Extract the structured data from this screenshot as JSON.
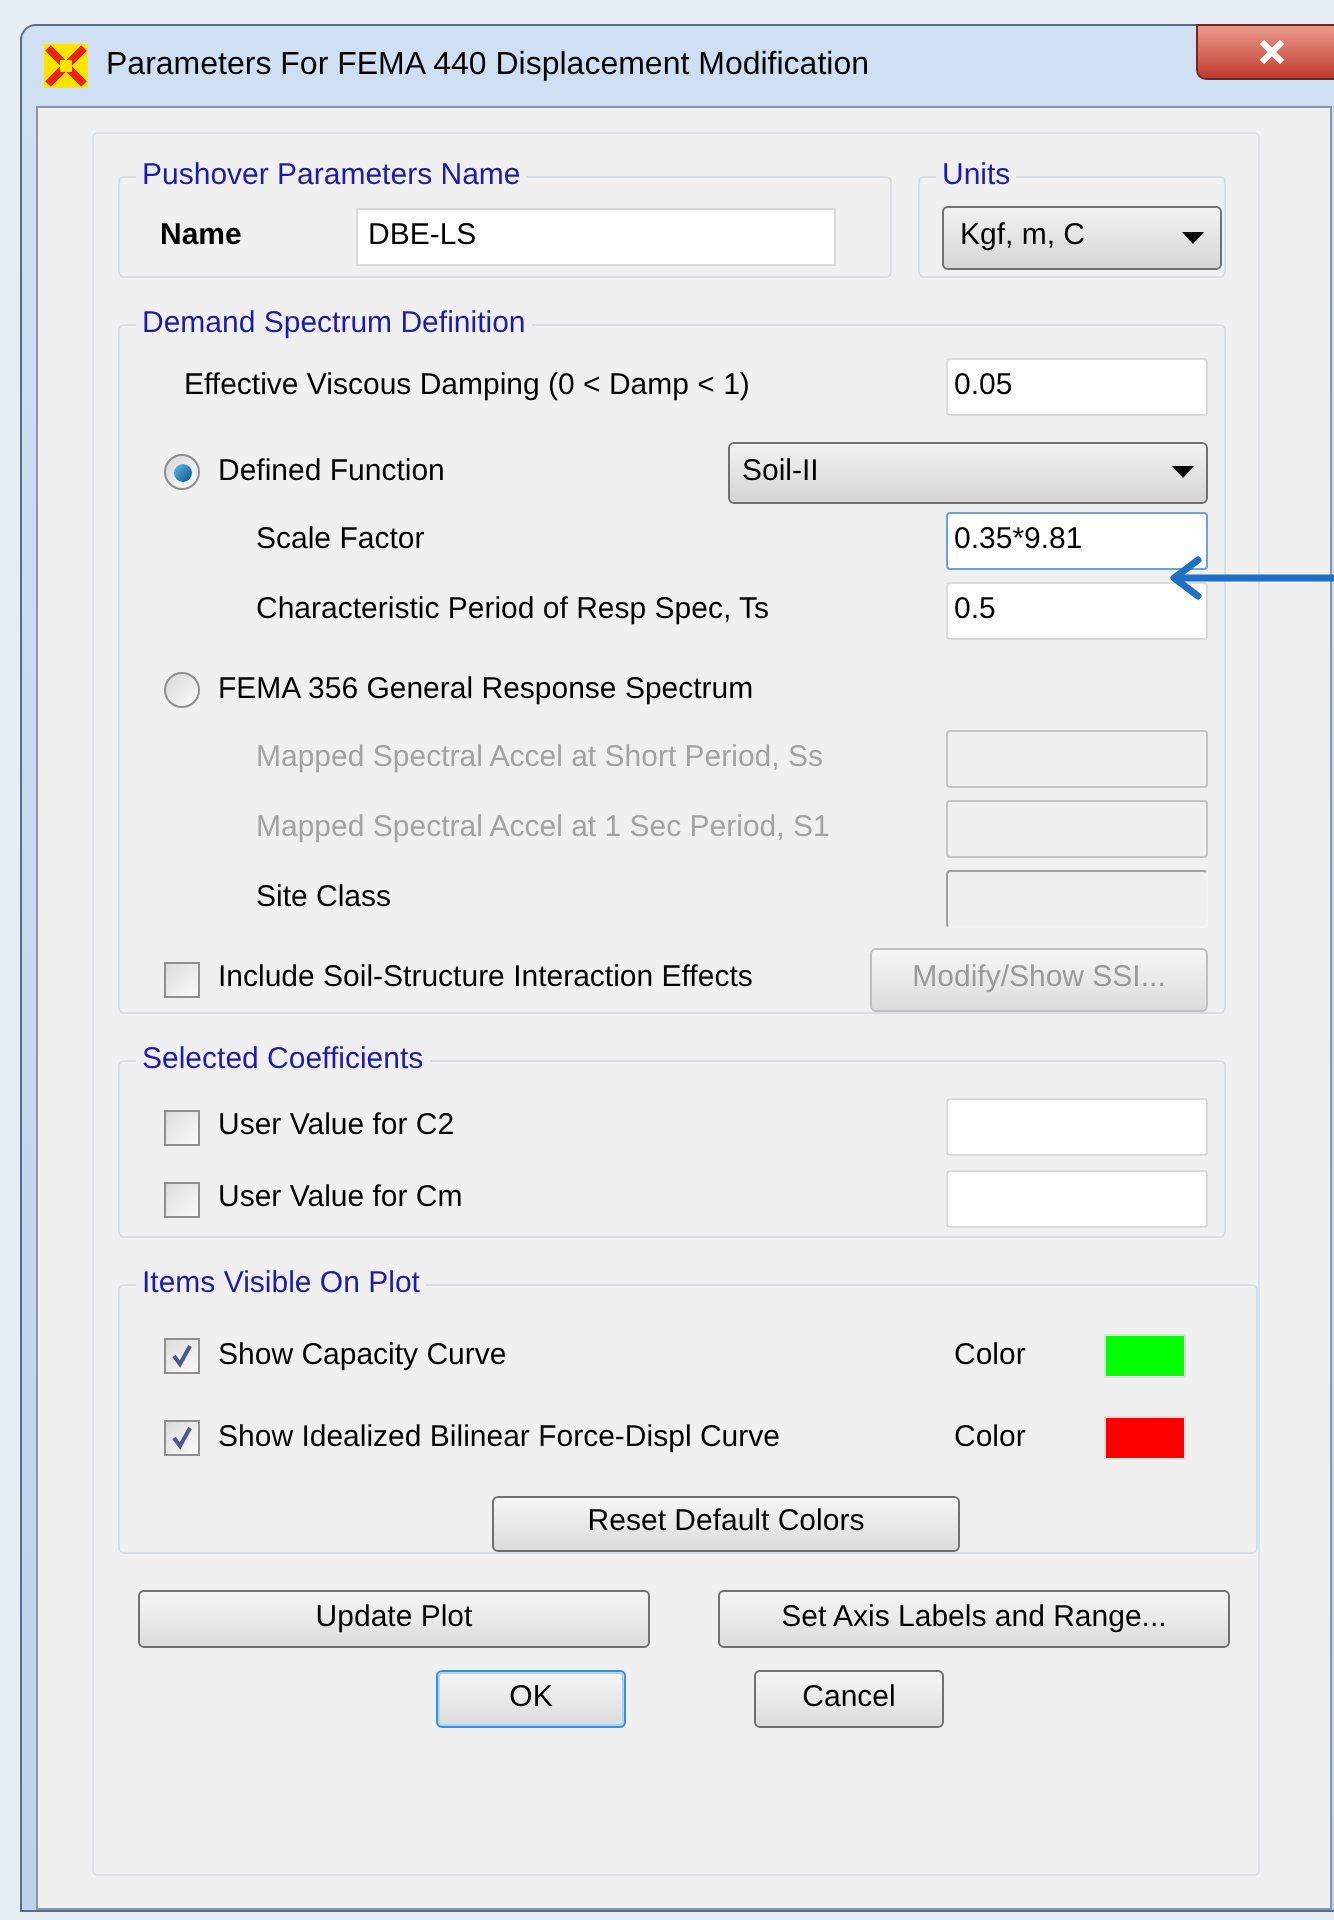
{
  "window": {
    "title": "Parameters For FEMA 440 Displacement Modification"
  },
  "pushover": {
    "title": "Pushover Parameters Name",
    "name_label": "Name",
    "name_value": "DBE-LS"
  },
  "units": {
    "title": "Units",
    "value": "Kgf, m, C"
  },
  "demand_spectrum": {
    "title": "Demand Spectrum Definition",
    "damping": {
      "label": "Effective Viscous Damping  (0 < Damp < 1)",
      "value": "0.05"
    },
    "options": [
      {
        "label": "Defined Function",
        "selected": true,
        "dropdown": "Soil-II",
        "fields": [
          {
            "label": "Scale Factor",
            "value": "0.35*9.81",
            "disabled": false,
            "focused": true
          },
          {
            "label": "Characteristic Period of Resp Spec, Ts",
            "value": "0.5",
            "disabled": false,
            "focused": false
          }
        ]
      },
      {
        "label": "FEMA 356 General Response Spectrum",
        "selected": false,
        "fields": [
          {
            "label": "Mapped Spectral Accel at Short Period, Ss",
            "disabled": true,
            "focused": false
          },
          {
            "label": "Mapped Spectral Accel at 1 Sec Period, S1",
            "disabled": true,
            "focused": false
          },
          {
            "label": "Site Class",
            "disabled": false,
            "focused": false
          }
        ]
      }
    ],
    "ssi": {
      "label": "Include Soil-Structure Interaction Effects",
      "checked": false,
      "button": {
        "label": "Modify/Show SSI...",
        "disabled": true
      }
    }
  },
  "coefficients": {
    "title": "Selected Coefficients",
    "items": [
      {
        "label": "User Value for C2",
        "checked": false
      },
      {
        "label": "User Value for Cm",
        "checked": false
      }
    ]
  },
  "plot_items": {
    "title": "Items Visible On Plot",
    "items": [
      {
        "label": "Show Capacity Curve",
        "checked": true,
        "color_label": "Color",
        "color": "#00ff00"
      },
      {
        "label": "Show Idealized Bilinear Force-Displ Curve",
        "checked": true,
        "color_label": "Color",
        "color": "#ff0000"
      }
    ],
    "reset_button": "Reset Default Colors"
  },
  "action_buttons": [
    {
      "label": "Update Plot"
    },
    {
      "label": "Set Axis Labels and Range..."
    }
  ],
  "dialog_buttons": [
    {
      "label": "OK",
      "default": true
    },
    {
      "label": "Cancel",
      "default": false
    }
  ]
}
